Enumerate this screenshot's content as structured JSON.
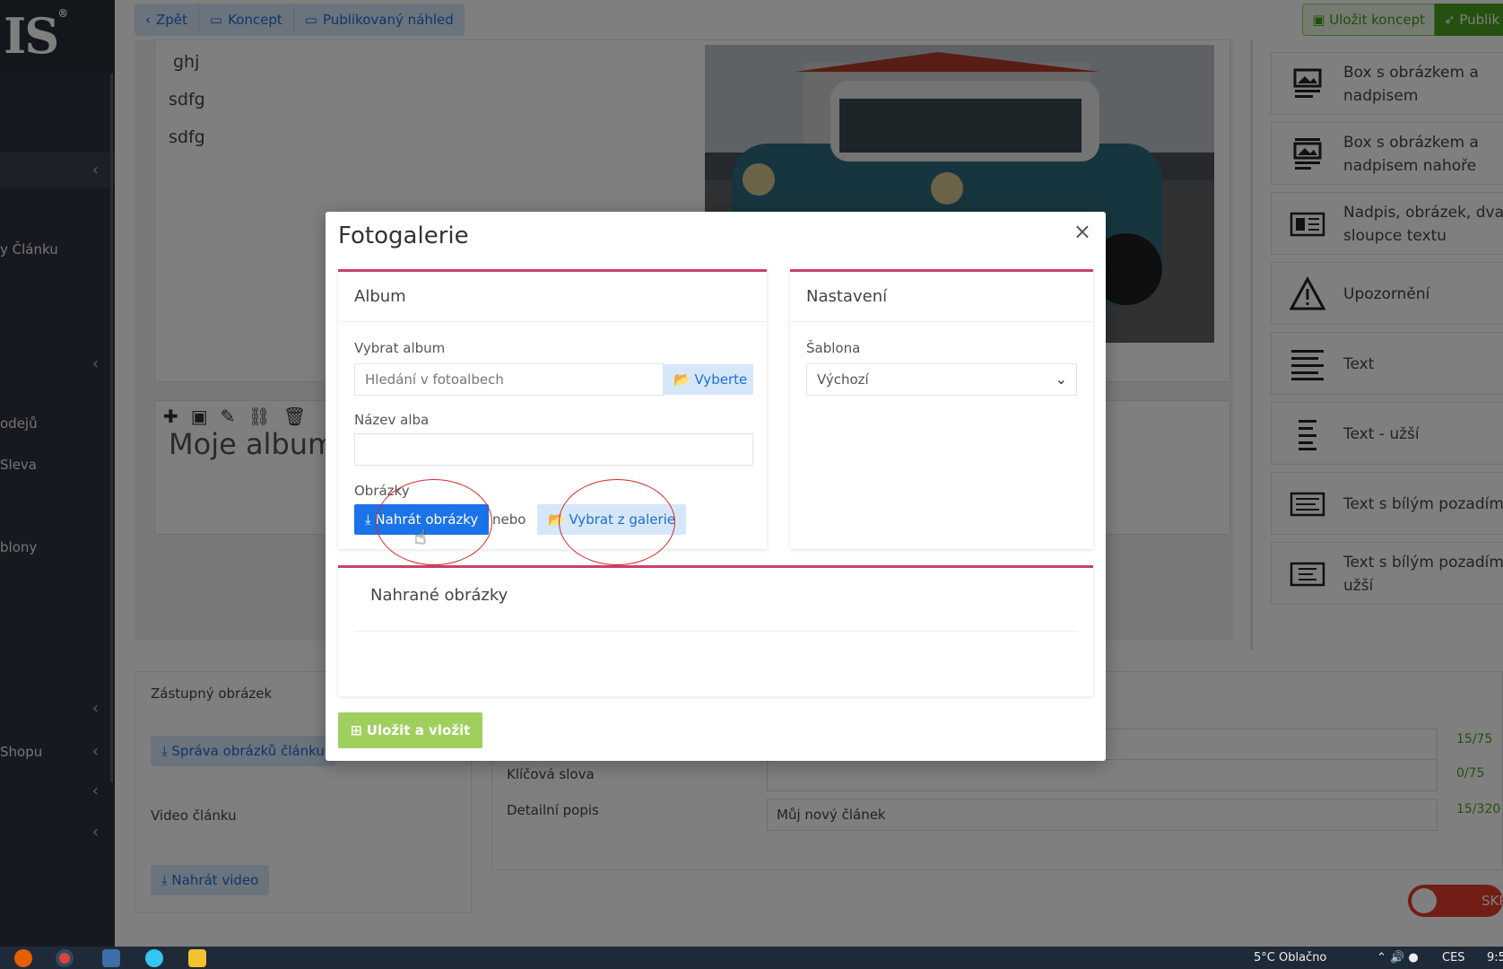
{
  "app": {
    "logo_text": "IS",
    "logo_mark": "®"
  },
  "sidebar": {
    "items": [
      {
        "label": "",
        "chevron": "‹"
      },
      {
        "label": "y Článku",
        "chevron": ""
      },
      {
        "label": "",
        "chevron": "‹"
      },
      {
        "label": "odejů",
        "chevron": ""
      },
      {
        "label": "Sleva",
        "chevron": ""
      },
      {
        "label": "blony",
        "chevron": ""
      },
      {
        "label": "",
        "chevron": "‹"
      },
      {
        "label": "Shopu",
        "chevron": "‹"
      },
      {
        "label": "",
        "chevron": "‹"
      },
      {
        "label": "",
        "chevron": "‹"
      }
    ]
  },
  "topbar": {
    "back_label": "Zpět",
    "draft_label": "Koncept",
    "preview_label": "Publikovaný náhled",
    "save_draft_label": "Uložit koncept",
    "publish_label": "Publik"
  },
  "editor": {
    "lines": [
      "ghj",
      "sdfg",
      "sdfg"
    ],
    "album_heading": "Moje album"
  },
  "palette": {
    "items": [
      {
        "label": "Box s obrázkem a nadpisem",
        "icon": "image-text-icon"
      },
      {
        "label": "Box s obrázkem a nadpisem nahoře",
        "icon": "image-top-icon"
      },
      {
        "label": "Nadpis, obrázek, dva sloupce textu",
        "icon": "columns-icon"
      },
      {
        "label": "Upozornění",
        "icon": "warning-icon"
      },
      {
        "label": "Text",
        "icon": "text-icon"
      },
      {
        "label": "Text - užší",
        "icon": "text-narrow-icon"
      },
      {
        "label": "Text s bílým pozadím",
        "icon": "text-box-icon"
      },
      {
        "label": "Text s bílým pozadím - užší",
        "icon": "text-box-narrow-icon"
      }
    ]
  },
  "lower": {
    "placeholder_image_label": "Zástupný obrázek",
    "manage_images_label": "Správa obrázků článku",
    "video_label": "Video článku",
    "upload_video_label": "Nahrát video",
    "keywords_label": "Klíčová slova",
    "detail_label": "Detailní popis",
    "detail_value": "Můj nový článek",
    "counters": [
      "15/75",
      "0/75",
      "15/320"
    ],
    "toggle_label": "SKR"
  },
  "modal": {
    "title": "Fotogalerie",
    "close_glyph": "×",
    "album_panel": {
      "title": "Album",
      "choose_album_label": "Vybrat album",
      "search_placeholder": "Hledání v fotoalbech",
      "choose_button": "Vyberte",
      "album_name_label": "Název alba",
      "album_name_value": "",
      "images_label": "Obrázky",
      "upload_button": "Nahrát obrázky",
      "or_text": "nebo",
      "from_gallery_button": "Vybrat z galerie"
    },
    "settings_panel": {
      "title": "Nastavení",
      "template_label": "Šablona",
      "template_value": "Výchozí"
    },
    "uploaded_panel": {
      "title": "Nahrané obrázky"
    },
    "save_insert_button": "Uložit a vložit"
  },
  "taskbar": {
    "weather": "5°C  Oblačno",
    "lang": "CES",
    "time": "9:5"
  },
  "colors": {
    "accent_blue": "#1a73e8",
    "light_blue": "#d7e7fa",
    "panel_border": "#c9416a",
    "green": "#9fd05e",
    "annotation_red": "#d42a2a"
  }
}
